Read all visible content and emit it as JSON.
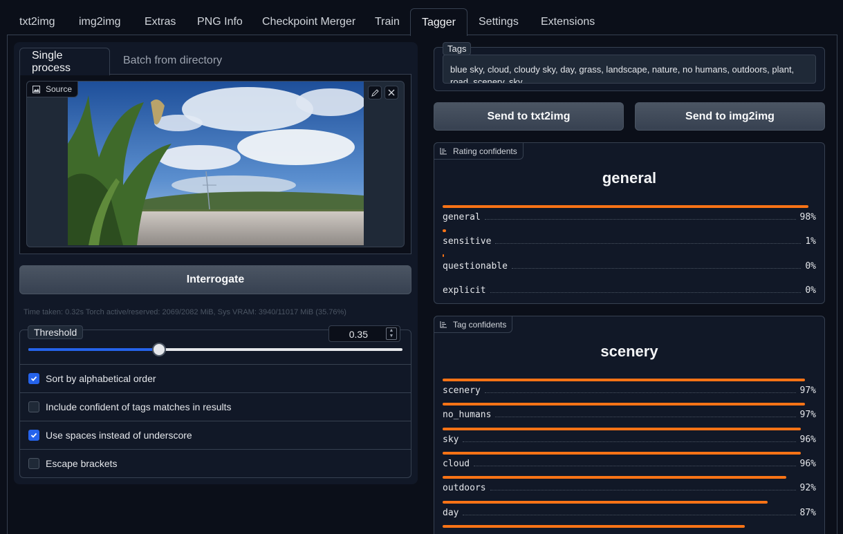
{
  "top_tabs": [
    "txt2img",
    "img2img",
    "Extras",
    "PNG Info",
    "Checkpoint Merger",
    "Train",
    "Tagger",
    "Settings",
    "Extensions"
  ],
  "active_top_tab": "Tagger",
  "left": {
    "sub_tabs": [
      "Single process",
      "Batch from directory"
    ],
    "source_label": "Source",
    "interrogate_label": "Interrogate",
    "timing_text": "Time taken: 0.32s  Torch active/reserved: 2069/2082 MiB, Sys VRAM: 3940/11017 MiB (35.76%)",
    "threshold": {
      "label": "Threshold",
      "value": "0.35",
      "fraction": 0.35
    },
    "options": [
      {
        "label": "Sort by alphabetical order",
        "checked": true
      },
      {
        "label": "Include confident of tags matches in results",
        "checked": false
      },
      {
        "label": "Use spaces instead of underscore",
        "checked": true
      },
      {
        "label": "Escape brackets",
        "checked": false
      }
    ]
  },
  "right": {
    "tags_label": "Tags",
    "tags_text": "blue sky, cloud, cloudy sky, day, grass, landscape, nature, no humans, outdoors, plant, road, scenery, sky",
    "send_txt2img": "Send to txt2img",
    "send_img2img": "Send to img2img",
    "rating": {
      "label": "Rating confidents",
      "top": "general",
      "items": [
        {
          "name": "general",
          "pct": "98%",
          "value": 0.98
        },
        {
          "name": "sensitive",
          "pct": "1%",
          "value": 0.01
        },
        {
          "name": "questionable",
          "pct": "0%",
          "value": 0.002
        },
        {
          "name": "explicit",
          "pct": "0%",
          "value": 0.0
        }
      ]
    },
    "tags_conf": {
      "label": "Tag confidents",
      "top": "scenery",
      "items": [
        {
          "name": "scenery",
          "pct": "97%",
          "value": 0.97
        },
        {
          "name": "no_humans",
          "pct": "97%",
          "value": 0.97
        },
        {
          "name": "sky",
          "pct": "96%",
          "value": 0.96
        },
        {
          "name": "cloud",
          "pct": "96%",
          "value": 0.96
        },
        {
          "name": "outdoors",
          "pct": "92%",
          "value": 0.92
        },
        {
          "name": "day",
          "pct": "87%",
          "value": 0.87
        },
        {
          "name": "",
          "pct": "",
          "value": 0.81
        }
      ]
    }
  },
  "colors": {
    "accent_bar": "#f97316",
    "slider_fill": "#2563eb",
    "checkbox": "#2563eb"
  }
}
